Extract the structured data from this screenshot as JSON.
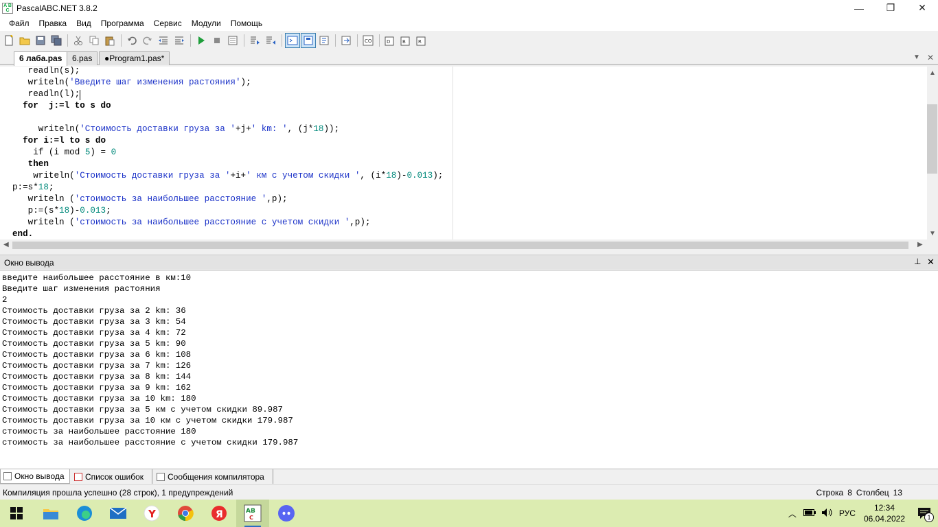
{
  "window": {
    "title": "PascalABC.NET 3.8.2",
    "minimize_glyph": "—",
    "maximize_glyph": "❐",
    "close_glyph": "✕"
  },
  "menu": [
    "Файл",
    "Правка",
    "Вид",
    "Программа",
    "Сервис",
    "Модули",
    "Помощь"
  ],
  "toolbar_icons": [
    "new-file-icon",
    "open-folder-icon",
    "save-icon",
    "save-all-icon",
    "cut-icon",
    "copy-icon",
    "paste-icon",
    "undo-icon",
    "redo-icon",
    "outdent-icon",
    "indent-icon",
    "run-icon",
    "stop-icon",
    "debug-icon",
    "step-into-icon",
    "step-over-icon",
    "output-window-icon",
    "form-view-icon",
    "code-view-icon",
    "navigation-icon",
    "compile-icon",
    "intellisense-icon",
    "format-code-icon",
    "breakpoint-icon",
    "refactor-icon"
  ],
  "tabs": [
    "6 лаба.pas",
    "6.pas",
    "●Program1.pas*"
  ],
  "code_lines": [
    "   readln(s);",
    "   writeln('Введите шаг изменения растояния');",
    "   readln(l);",
    "  for  j:=l to s do",
    "",
    "     writeln('Стоимость доставки груза за '+j+' km: ', (j*18));",
    "  for i:=l to s do",
    "    if (i mod 5) = 0",
    "   then",
    "    writeln('Стоимость доставки груза за '+i+' км с учетом скидки ', (i*18)-0.013);",
    "p:=s*18;",
    "   writeln ('стоимость за наибольшее расстояние ',p);",
    "   p:=(s*18)-0.013;",
    "   writeln ('стоимость за наибольшее расстояние с учетом скидки ',p);",
    "end."
  ],
  "output": {
    "title": "Окно вывода",
    "pin_glyph": "📌",
    "close_glyph": "✕",
    "lines": [
      "введите наибольшее расстояние в км:10",
      "Введите шаг изменения растояния",
      "2",
      "Стоимость доставки груза за 2 km: 36",
      "Стоимость доставки груза за 3 km: 54",
      "Стоимость доставки груза за 4 km: 72",
      "Стоимость доставки груза за 5 km: 90",
      "Стоимость доставки груза за 6 km: 108",
      "Стоимость доставки груза за 7 km: 126",
      "Стоимость доставки груза за 8 km: 144",
      "Стоимость доставки груза за 9 km: 162",
      "Стоимость доставки груза за 10 km: 180",
      "Стоимость доставки груза за 5 км с учетом скидки 89.987",
      "Стоимость доставки груза за 10 км с учетом скидки 179.987",
      "стоимость за наибольшее расстояние 180",
      "стоимость за наибольшее расстояние с учетом скидки 179.987"
    ]
  },
  "bottom_tabs": [
    "Окно вывода",
    "Список ошибок",
    "Сообщения компилятора"
  ],
  "status": {
    "message": "Компиляция прошла успешно (28 строк), 1 предупреждений",
    "row_label": "Строка",
    "row_value": "8",
    "col_label": "Столбец",
    "col_value": "13"
  },
  "taskbar": {
    "apps": [
      "start-icon",
      "file-explorer-icon",
      "edge-icon",
      "mail-icon",
      "yandex-icon",
      "chrome-icon",
      "yandex-browser-icon",
      "pascalabc-icon",
      "discord-icon"
    ],
    "lang": "РУС",
    "time": "12:34",
    "date": "06.04.2022",
    "notification_count": "1"
  },
  "colors": {
    "string": "#1b32c8",
    "number": "#00897b",
    "taskbar": "#dcecb1"
  }
}
